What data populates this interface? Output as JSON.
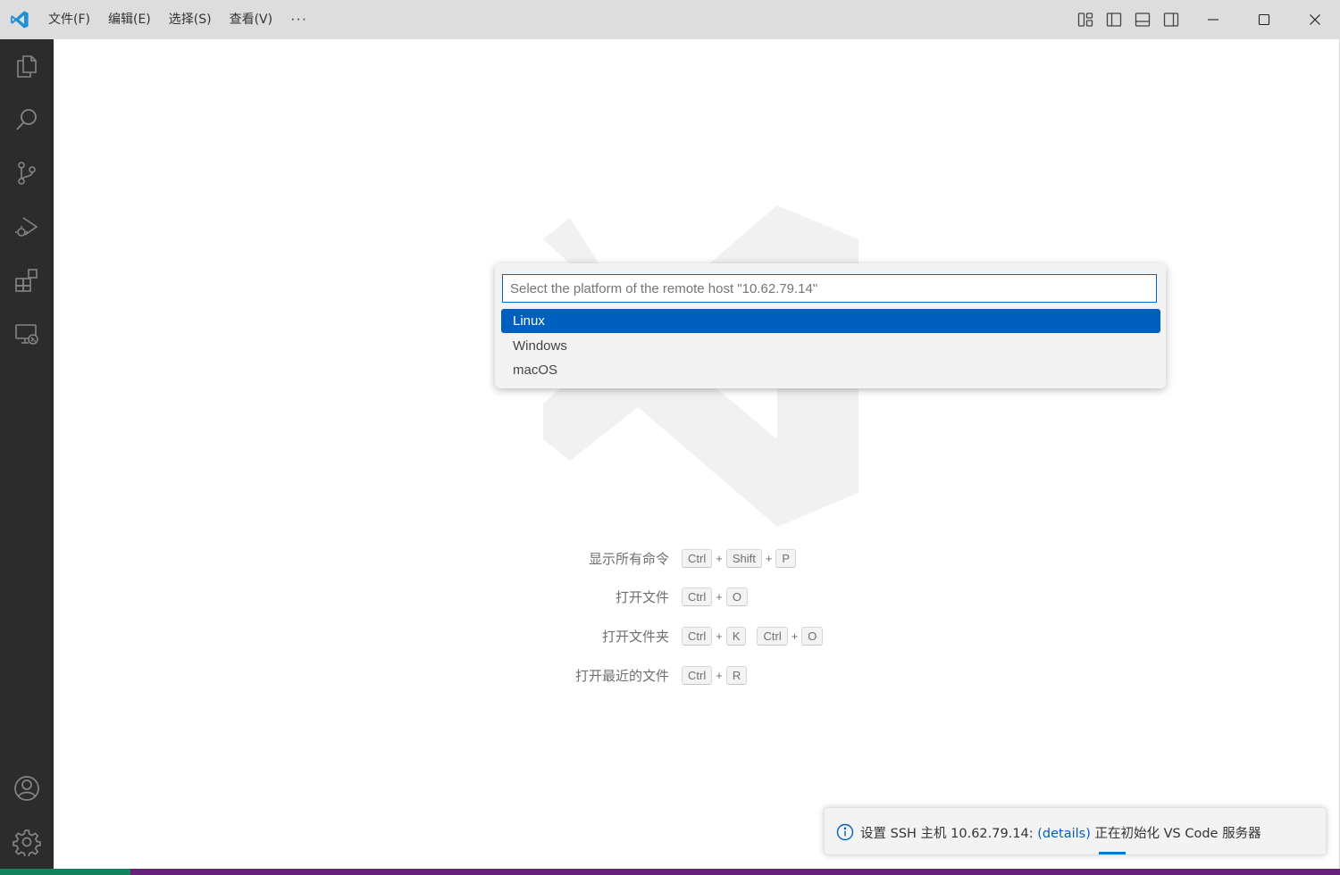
{
  "titlebar": {
    "menu": [
      "文件(F)",
      "编辑(E)",
      "选择(S)",
      "查看(V)"
    ],
    "more_label": "···",
    "layout_icons": [
      "customize-layout-icon",
      "toggle-primary-sidebar-icon",
      "toggle-panel-icon",
      "toggle-secondary-sidebar-icon"
    ],
    "window_icons": [
      "minimize-icon",
      "maximize-icon",
      "close-icon"
    ]
  },
  "activitybar": {
    "items": [
      "explorer-icon",
      "search-icon",
      "source-control-icon",
      "run-debug-icon",
      "extensions-icon",
      "remote-explorer-icon"
    ],
    "bottom": [
      "accounts-icon",
      "manage-gear-icon"
    ]
  },
  "quickpick": {
    "placeholder": "Select the platform of the remote host \"10.62.79.14\"",
    "options": [
      "Linux",
      "Windows",
      "macOS"
    ],
    "selected": "Linux"
  },
  "shortcuts": [
    {
      "label": "显示所有命令",
      "keys": [
        [
          "Ctrl",
          "Shift",
          "P"
        ]
      ]
    },
    {
      "label": "打开文件",
      "keys": [
        [
          "Ctrl",
          "O"
        ]
      ]
    },
    {
      "label": "打开文件夹",
      "keys": [
        [
          "Ctrl",
          "K"
        ],
        [
          "Ctrl",
          "O"
        ]
      ]
    },
    {
      "label": "打开最近的文件",
      "keys": [
        [
          "Ctrl",
          "R"
        ]
      ]
    }
  ],
  "notification": {
    "prefix": "设置 SSH 主机 10.62.79.14: ",
    "link": "(details)",
    "suffix": " 正在初始化 VS Code 服务器"
  },
  "colors": {
    "accent": "#0060c0",
    "activitybar": "#2c2c2c",
    "titlebar": "#dddddd",
    "statusbar": "#68217a",
    "remote_indicator": "#16825d"
  }
}
